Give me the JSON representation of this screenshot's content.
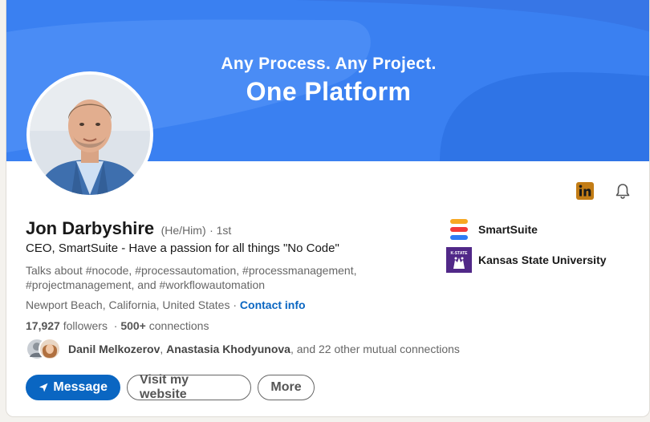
{
  "banner": {
    "line1": "Any Process. Any Project.",
    "line2": "One Platform",
    "background_color": "#3a80f1"
  },
  "profile": {
    "name": "Jon Darbyshire",
    "pronouns": "(He/Him)",
    "degree": "· 1st",
    "headline": "CEO, SmartSuite - Have a passion for all things \"No Code\"",
    "talks_about": "Talks about #nocode, #processautomation, #processmanagement, #projectmanagement, and #workflowautomation",
    "location": "Newport Beach, California, United States",
    "location_separator": "·",
    "contact_info_label": "Contact info",
    "followers_count": "17,927",
    "followers_label": "followers",
    "connections_separator": "·",
    "connections_count": "500+",
    "connections_label": "connections"
  },
  "mutual": {
    "name1": "Danil Melkozerov",
    "separator": ",",
    "name2": "Anastasia Khodyunova",
    "rest": ", and 22 other mutual connections"
  },
  "actions": {
    "message_label": "Message",
    "visit_label": "Visit my website",
    "more_label": "More"
  },
  "organizations": [
    {
      "name": "SmartSuite",
      "icon": "smartsuite-logo-icon"
    },
    {
      "name": "Kansas State University",
      "icon": "kstate-logo-icon",
      "logo_text": "K-STATE"
    }
  ],
  "top_icons": [
    "linkedin-icon",
    "bell-icon"
  ],
  "colors": {
    "link": "#0a66c2",
    "primary_button": "#0a66c2",
    "linkedin_badge": "#c37d16"
  }
}
